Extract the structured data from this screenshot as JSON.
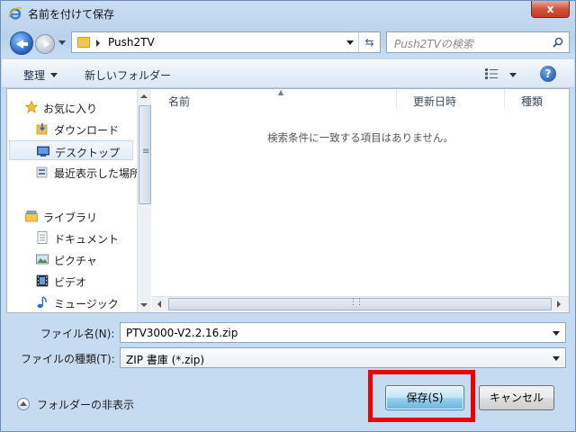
{
  "window": {
    "title": "名前を付けて保存",
    "close_label": "x"
  },
  "address": {
    "path": "Push2TV"
  },
  "search": {
    "placeholder": "Push2TVの検索"
  },
  "toolbar": {
    "organize_label": "整理",
    "new_folder_label": "新しいフォルダー"
  },
  "nav": {
    "favorites": {
      "label": "お気に入り",
      "items": [
        "ダウンロード",
        "デスクトップ",
        "最近表示した場所"
      ]
    },
    "libraries": {
      "label": "ライブラリ",
      "items": [
        "ドキュメント",
        "ピクチャ",
        "ビデオ",
        "ミュージック"
      ]
    }
  },
  "columns": [
    "名前",
    "更新日時",
    "種類"
  ],
  "empty_message": "検索条件に一致する項目はありません。",
  "form": {
    "filename_label": "ファイル名(N):",
    "filename_value": "PTV3000-V2.2.16.zip",
    "filetype_label": "ファイルの種類(T):",
    "filetype_value": "ZIP 書庫 (*.zip)"
  },
  "footer": {
    "hide_folders_label": "フォルダーの非表示",
    "save_label": "保存(S)",
    "cancel_label": "キャンセル"
  },
  "colors": {
    "highlight": "#ee0000",
    "close_button": "#c13a22"
  }
}
